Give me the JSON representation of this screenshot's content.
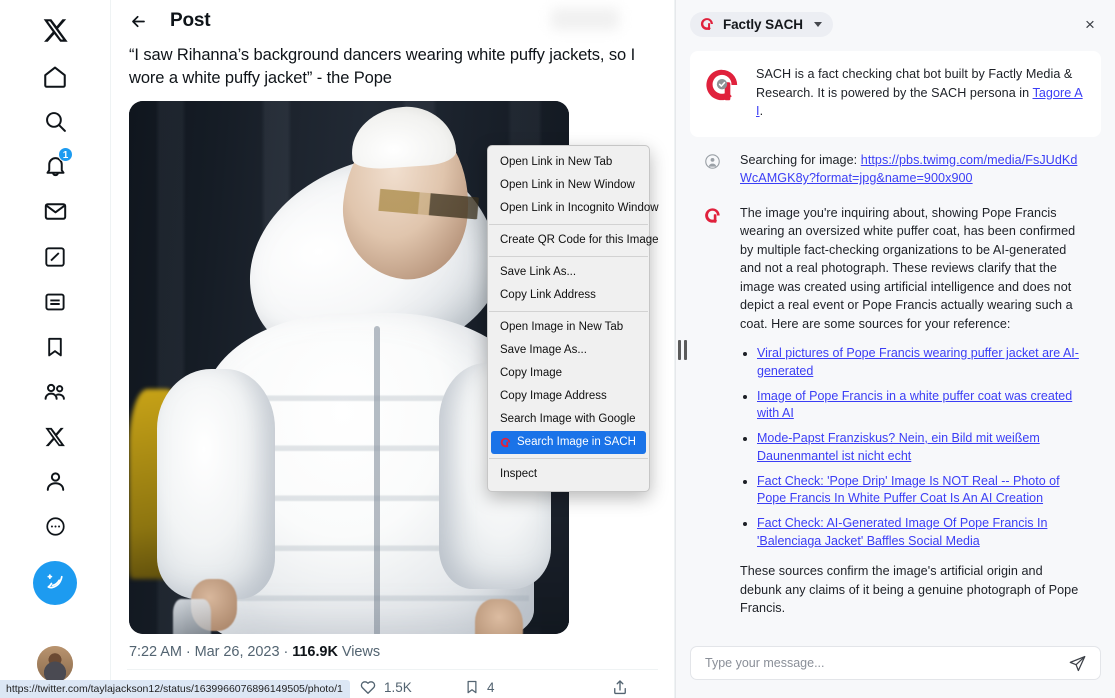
{
  "sidebar": {
    "items": [
      {
        "name": "x-logo",
        "label": "X"
      },
      {
        "name": "home",
        "label": "Home"
      },
      {
        "name": "search",
        "label": "Explore"
      },
      {
        "name": "notifications",
        "label": "Notifications",
        "badge": "1"
      },
      {
        "name": "messages",
        "label": "Messages"
      },
      {
        "name": "grok",
        "label": "Grok"
      },
      {
        "name": "lists",
        "label": "Lists"
      },
      {
        "name": "bookmarks",
        "label": "Bookmarks"
      },
      {
        "name": "communities",
        "label": "Communities"
      },
      {
        "name": "premium",
        "label": "Premium"
      },
      {
        "name": "profile",
        "label": "Profile"
      },
      {
        "name": "more",
        "label": "More"
      }
    ],
    "compose_label": "Post",
    "avatar_label": "Account"
  },
  "post": {
    "header_title": "Post",
    "back_label": "Back",
    "text": "“I saw Rihanna’s background dancers wearing white puffy jackets, so I wore a white puffy jacket” - the Pope",
    "image_alt": "Pope Francis wearing an oversized white puffer coat",
    "time": "7:22 AM",
    "date": "Mar 26, 2023",
    "views_count": "116.9K",
    "views_label": "Views",
    "meta_separator": "·",
    "actions": {
      "reply": "",
      "repost": "",
      "like_count": "1.5K",
      "bookmark_count": "4",
      "share": ""
    }
  },
  "context_menu": {
    "groups": [
      [
        "Open Link in New Tab",
        "Open Link in New Window",
        "Open Link in Incognito Window"
      ],
      [
        "Create QR Code for this Image"
      ],
      [
        "Save Link As...",
        "Copy Link Address"
      ],
      [
        "Open Image in New Tab",
        "Save Image As...",
        "Copy Image",
        "Copy Image Address",
        "Search Image with Google"
      ],
      [
        "Search Image in SACH"
      ],
      [
        "Inspect"
      ]
    ],
    "highlighted": "Search Image in SACH"
  },
  "chat": {
    "persona": "Factly SACH",
    "close_label": "×",
    "intro": {
      "text_before": "SACH is a fact checking chat bot built by Factly Media & Research. It is powered by the SACH persona in ",
      "link": "Tagore AI",
      "text_after": "."
    },
    "user_message": {
      "prefix": "Searching for image: ",
      "url": "https://pbs.twimg.com/media/FsJUdKdWcAMGK8y?format=jpg&name=900x900"
    },
    "bot_message": {
      "paragraph": "The image you're inquiring about, showing Pope Francis wearing an oversized white puffer coat, has been confirmed by multiple fact-checking organizations to be AI-generated and not a real photograph. These reviews clarify that the image was created using artificial intelligence and does not depict a real event or Pope Francis actually wearing such a coat. Here are some sources for your reference:",
      "sources": [
        "Viral pictures of Pope Francis wearing puffer jacket are AI-generated",
        "Image of Pope Francis in a white puffer coat was created with AI",
        "Mode-Papst Franziskus? Nein, ein Bild mit weißem Daunenmantel ist nicht echt",
        "Fact Check: 'Pope Drip' Image Is NOT Real -- Photo of Pope Francis In White Puffer Coat Is An AI Creation",
        "Fact Check: AI-Generated Image Of Pope Francis In 'Balenciaga Jacket' Baffles Social Media"
      ],
      "closing": "These sources confirm the image's artificial origin and debunk any claims of it being a genuine photograph of Pope Francis."
    },
    "input_placeholder": "Type your message...",
    "input_value": "",
    "send_label": "Send"
  },
  "status_bar": {
    "url": "https://twitter.com/taylajackson12/status/1639966076896149505/photo/1"
  },
  "colors": {
    "brand_blue": "#1d9bf0",
    "sach_red": "#e0213c",
    "link_blue": "#3b3ef5",
    "menu_highlight": "#1a73e8",
    "panel_bg": "#f7f8fa"
  }
}
